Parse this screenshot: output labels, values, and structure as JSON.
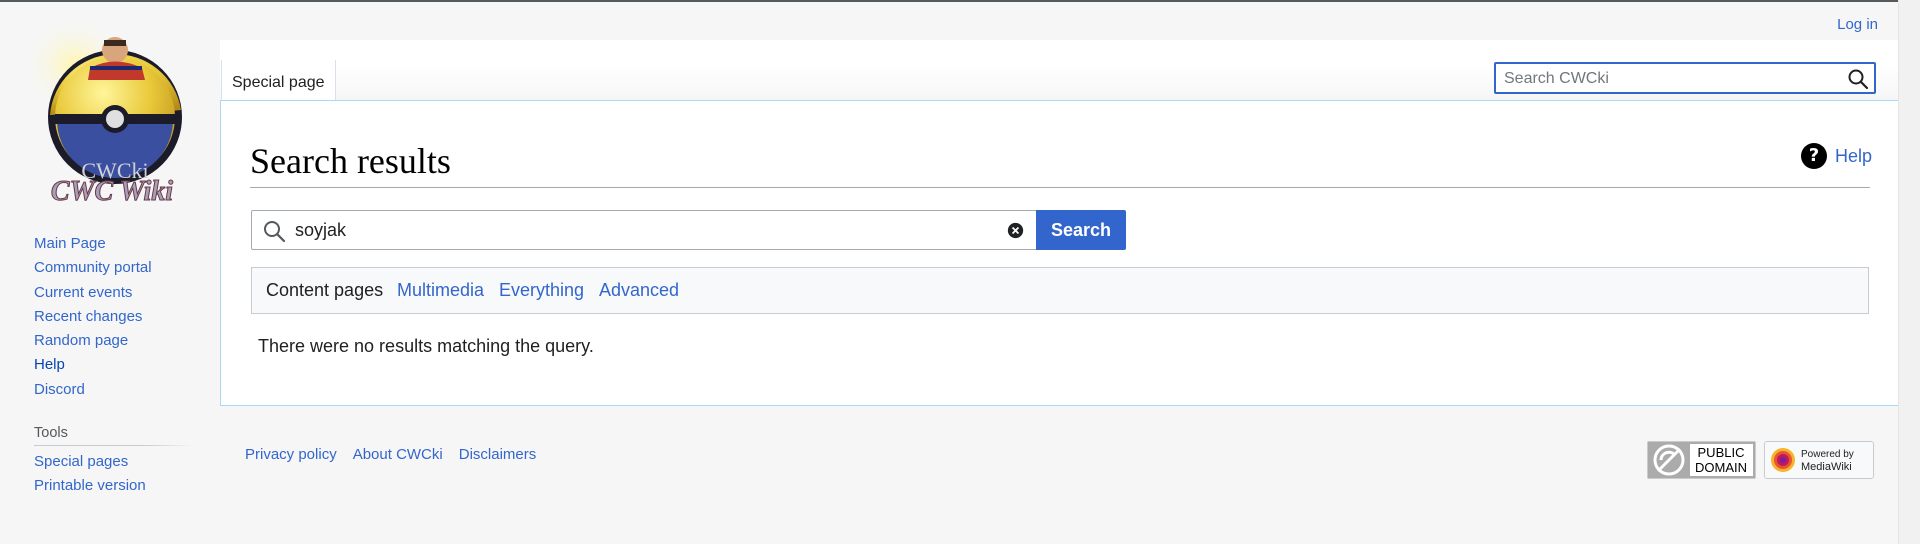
{
  "site": {
    "logo_text_top": "CWCki",
    "logo_text_bottom": "CWC Wiki"
  },
  "personal": {
    "login_label": "Log in"
  },
  "tabs": [
    {
      "label": "Special page"
    }
  ],
  "header_search": {
    "placeholder": "Search CWCki",
    "value": ""
  },
  "page": {
    "title": "Search results",
    "help_label": "Help",
    "help_icon_glyph": "?"
  },
  "search": {
    "query": "soyjak",
    "submit_label": "Search",
    "profiles": [
      {
        "label": "Content pages",
        "active": true
      },
      {
        "label": "Multimedia",
        "active": false
      },
      {
        "label": "Everything",
        "active": false
      },
      {
        "label": "Advanced",
        "active": false
      }
    ],
    "no_results_text": "There were no results matching the query."
  },
  "sidebar": {
    "navigation": [
      {
        "label": "Main Page"
      },
      {
        "label": "Community portal"
      },
      {
        "label": "Current events"
      },
      {
        "label": "Recent changes"
      },
      {
        "label": "Random page"
      },
      {
        "label": "Help"
      },
      {
        "label": "Discord"
      }
    ],
    "tools_heading": "Tools",
    "tools": [
      {
        "label": "Special pages"
      },
      {
        "label": "Printable version"
      }
    ]
  },
  "footer": {
    "links": [
      {
        "label": "Privacy policy"
      },
      {
        "label": "About CWCki"
      },
      {
        "label": "Disclaimers"
      }
    ],
    "badges": {
      "public_domain_line1": "PUBLIC",
      "public_domain_line2": "DOMAIN",
      "mediawiki_line1": "Powered by",
      "mediawiki_line2": "MediaWiki"
    }
  },
  "colors": {
    "link": "#3366cc",
    "accent_button": "#3366cc",
    "content_border": "#a7d7f9",
    "page_background": "#f6f6f6"
  }
}
